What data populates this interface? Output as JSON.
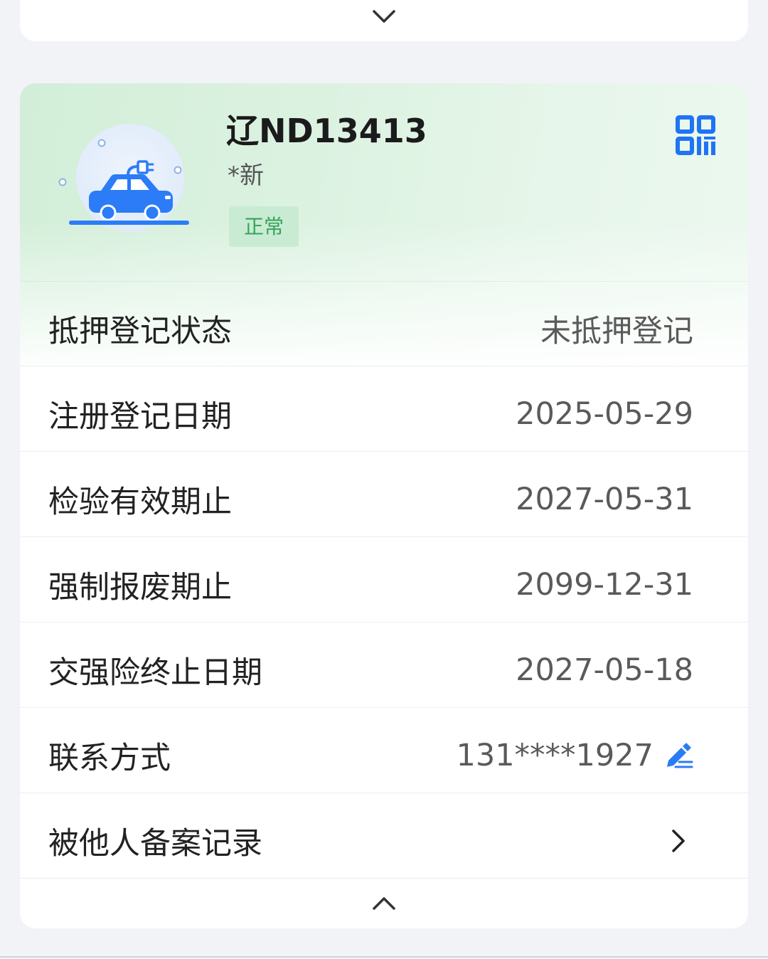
{
  "top_card": {
    "expand_icon": "chevron-down-icon"
  },
  "vehicle": {
    "plate": "辽ND13413",
    "energy_type": "*新",
    "status": "正常",
    "car_icon": "electric-car-icon",
    "qr_icon": "qr-code-icon"
  },
  "details": [
    {
      "label": "抵押登记状态",
      "value": "未抵押登记"
    },
    {
      "label": "注册登记日期",
      "value": "2025-05-29"
    },
    {
      "label": "检验有效期止",
      "value": "2027-05-31"
    },
    {
      "label": "强制报废期止",
      "value": "2099-12-31"
    },
    {
      "label": "交强险终止日期",
      "value": "2027-05-18"
    },
    {
      "label": "联系方式",
      "value": "131****1927",
      "action_icon": "edit-icon"
    },
    {
      "label": "被他人备案记录",
      "action_icon": "chevron-right-icon"
    }
  ],
  "collapse_icon": "chevron-up-icon",
  "colors": {
    "accent_blue": "#2b7cf6",
    "status_green": "#36a35a",
    "status_badge_bg": "#c9ebd3",
    "header_green": "#d2eed8",
    "page_bg": "#f2f3f7"
  }
}
